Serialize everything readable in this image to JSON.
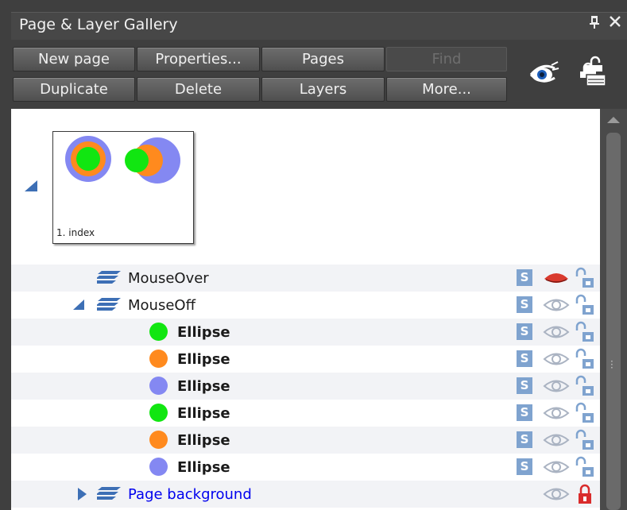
{
  "panel": {
    "title": "Page & Layer Gallery",
    "pin_glyph": "p",
    "close_glyph": "✕"
  },
  "toolbar": {
    "new_page": "New  page",
    "properties": "Properties...",
    "pages": "Pages",
    "find": "Find",
    "duplicate": "Duplicate",
    "delete": "Delete",
    "layers": "Layers",
    "more": "More..."
  },
  "page": {
    "thumbnail_label": "1. index"
  },
  "layers": [
    {
      "name": "MouseOver",
      "visible_state": "red-eye-closed"
    },
    {
      "name": "MouseOff",
      "visible_state": "eye-open"
    }
  ],
  "objects": [
    {
      "name": "Ellipse",
      "color": "#11e611"
    },
    {
      "name": "Ellipse",
      "color": "#ff8a1e"
    },
    {
      "name": "Ellipse",
      "color": "#8488f2"
    },
    {
      "name": "Ellipse",
      "color": "#11e611"
    },
    {
      "name": "Ellipse",
      "color": "#ff8a1e"
    },
    {
      "name": "Ellipse",
      "color": "#8488f2"
    }
  ],
  "background_layer": {
    "name": "Page background"
  },
  "colors": {
    "layer_blue": "#3d6fb5",
    "lock_red": "#d92b2b",
    "eye_red": "#d93a2e",
    "s_badge": "#7fa3cf"
  }
}
